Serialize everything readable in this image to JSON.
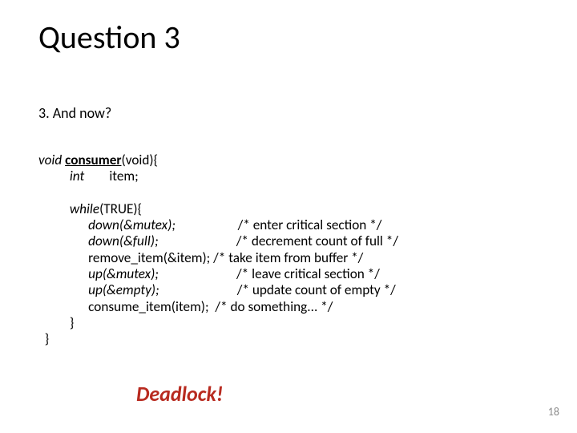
{
  "title": "Question 3",
  "prompt": "3. And now?",
  "code": {
    "kw_void": "void",
    "fn": "consumer",
    "sig_tail": "(void){",
    "kw_int": "int",
    "decl_item": "        item;",
    "kw_while": "while",
    "while_cond": "(TRUE){",
    "down_mutex": "down(&mutex);",
    "cmt_down_mutex": "                    /* enter critical section */",
    "down_full": "down(&full);",
    "cmt_down_full": "                         /* decrement count of full */",
    "remove_item": "remove_item(&item); /* take item from buffer */",
    "up_mutex": "up(&mutex);",
    "cmt_up_mutex": "                         /* leave critical section */",
    "up_empty": "up(&empty);",
    "cmt_up_empty": "                         /* update count of empty */",
    "consume_item": "consume_item(item);  /* do something... */",
    "brace1": "}",
    "brace2": "}"
  },
  "deadlock": "Deadlock!",
  "page": "18"
}
